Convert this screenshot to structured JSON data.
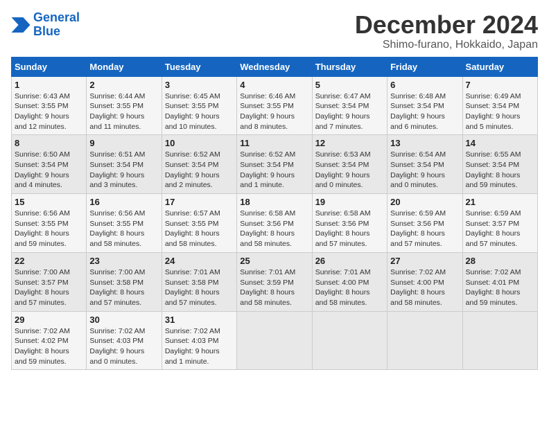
{
  "header": {
    "logo_line1": "General",
    "logo_line2": "Blue",
    "month": "December 2024",
    "location": "Shimo-furano, Hokkaido, Japan"
  },
  "weekdays": [
    "Sunday",
    "Monday",
    "Tuesday",
    "Wednesday",
    "Thursday",
    "Friday",
    "Saturday"
  ],
  "weeks": [
    [
      {
        "day": "1",
        "info": "Sunrise: 6:43 AM\nSunset: 3:55 PM\nDaylight: 9 hours\nand 12 minutes."
      },
      {
        "day": "2",
        "info": "Sunrise: 6:44 AM\nSunset: 3:55 PM\nDaylight: 9 hours\nand 11 minutes."
      },
      {
        "day": "3",
        "info": "Sunrise: 6:45 AM\nSunset: 3:55 PM\nDaylight: 9 hours\nand 10 minutes."
      },
      {
        "day": "4",
        "info": "Sunrise: 6:46 AM\nSunset: 3:55 PM\nDaylight: 9 hours\nand 8 minutes."
      },
      {
        "day": "5",
        "info": "Sunrise: 6:47 AM\nSunset: 3:54 PM\nDaylight: 9 hours\nand 7 minutes."
      },
      {
        "day": "6",
        "info": "Sunrise: 6:48 AM\nSunset: 3:54 PM\nDaylight: 9 hours\nand 6 minutes."
      },
      {
        "day": "7",
        "info": "Sunrise: 6:49 AM\nSunset: 3:54 PM\nDaylight: 9 hours\nand 5 minutes."
      }
    ],
    [
      {
        "day": "8",
        "info": "Sunrise: 6:50 AM\nSunset: 3:54 PM\nDaylight: 9 hours\nand 4 minutes."
      },
      {
        "day": "9",
        "info": "Sunrise: 6:51 AM\nSunset: 3:54 PM\nDaylight: 9 hours\nand 3 minutes."
      },
      {
        "day": "10",
        "info": "Sunrise: 6:52 AM\nSunset: 3:54 PM\nDaylight: 9 hours\nand 2 minutes."
      },
      {
        "day": "11",
        "info": "Sunrise: 6:52 AM\nSunset: 3:54 PM\nDaylight: 9 hours\nand 1 minute."
      },
      {
        "day": "12",
        "info": "Sunrise: 6:53 AM\nSunset: 3:54 PM\nDaylight: 9 hours\nand 0 minutes."
      },
      {
        "day": "13",
        "info": "Sunrise: 6:54 AM\nSunset: 3:54 PM\nDaylight: 9 hours\nand 0 minutes."
      },
      {
        "day": "14",
        "info": "Sunrise: 6:55 AM\nSunset: 3:54 PM\nDaylight: 8 hours\nand 59 minutes."
      }
    ],
    [
      {
        "day": "15",
        "info": "Sunrise: 6:56 AM\nSunset: 3:55 PM\nDaylight: 8 hours\nand 59 minutes."
      },
      {
        "day": "16",
        "info": "Sunrise: 6:56 AM\nSunset: 3:55 PM\nDaylight: 8 hours\nand 58 minutes."
      },
      {
        "day": "17",
        "info": "Sunrise: 6:57 AM\nSunset: 3:55 PM\nDaylight: 8 hours\nand 58 minutes."
      },
      {
        "day": "18",
        "info": "Sunrise: 6:58 AM\nSunset: 3:56 PM\nDaylight: 8 hours\nand 58 minutes."
      },
      {
        "day": "19",
        "info": "Sunrise: 6:58 AM\nSunset: 3:56 PM\nDaylight: 8 hours\nand 57 minutes."
      },
      {
        "day": "20",
        "info": "Sunrise: 6:59 AM\nSunset: 3:56 PM\nDaylight: 8 hours\nand 57 minutes."
      },
      {
        "day": "21",
        "info": "Sunrise: 6:59 AM\nSunset: 3:57 PM\nDaylight: 8 hours\nand 57 minutes."
      }
    ],
    [
      {
        "day": "22",
        "info": "Sunrise: 7:00 AM\nSunset: 3:57 PM\nDaylight: 8 hours\nand 57 minutes."
      },
      {
        "day": "23",
        "info": "Sunrise: 7:00 AM\nSunset: 3:58 PM\nDaylight: 8 hours\nand 57 minutes."
      },
      {
        "day": "24",
        "info": "Sunrise: 7:01 AM\nSunset: 3:58 PM\nDaylight: 8 hours\nand 57 minutes."
      },
      {
        "day": "25",
        "info": "Sunrise: 7:01 AM\nSunset: 3:59 PM\nDaylight: 8 hours\nand 58 minutes."
      },
      {
        "day": "26",
        "info": "Sunrise: 7:01 AM\nSunset: 4:00 PM\nDaylight: 8 hours\nand 58 minutes."
      },
      {
        "day": "27",
        "info": "Sunrise: 7:02 AM\nSunset: 4:00 PM\nDaylight: 8 hours\nand 58 minutes."
      },
      {
        "day": "28",
        "info": "Sunrise: 7:02 AM\nSunset: 4:01 PM\nDaylight: 8 hours\nand 59 minutes."
      }
    ],
    [
      {
        "day": "29",
        "info": "Sunrise: 7:02 AM\nSunset: 4:02 PM\nDaylight: 8 hours\nand 59 minutes."
      },
      {
        "day": "30",
        "info": "Sunrise: 7:02 AM\nSunset: 4:03 PM\nDaylight: 9 hours\nand 0 minutes."
      },
      {
        "day": "31",
        "info": "Sunrise: 7:02 AM\nSunset: 4:03 PM\nDaylight: 9 hours\nand 1 minute."
      },
      null,
      null,
      null,
      null
    ]
  ]
}
